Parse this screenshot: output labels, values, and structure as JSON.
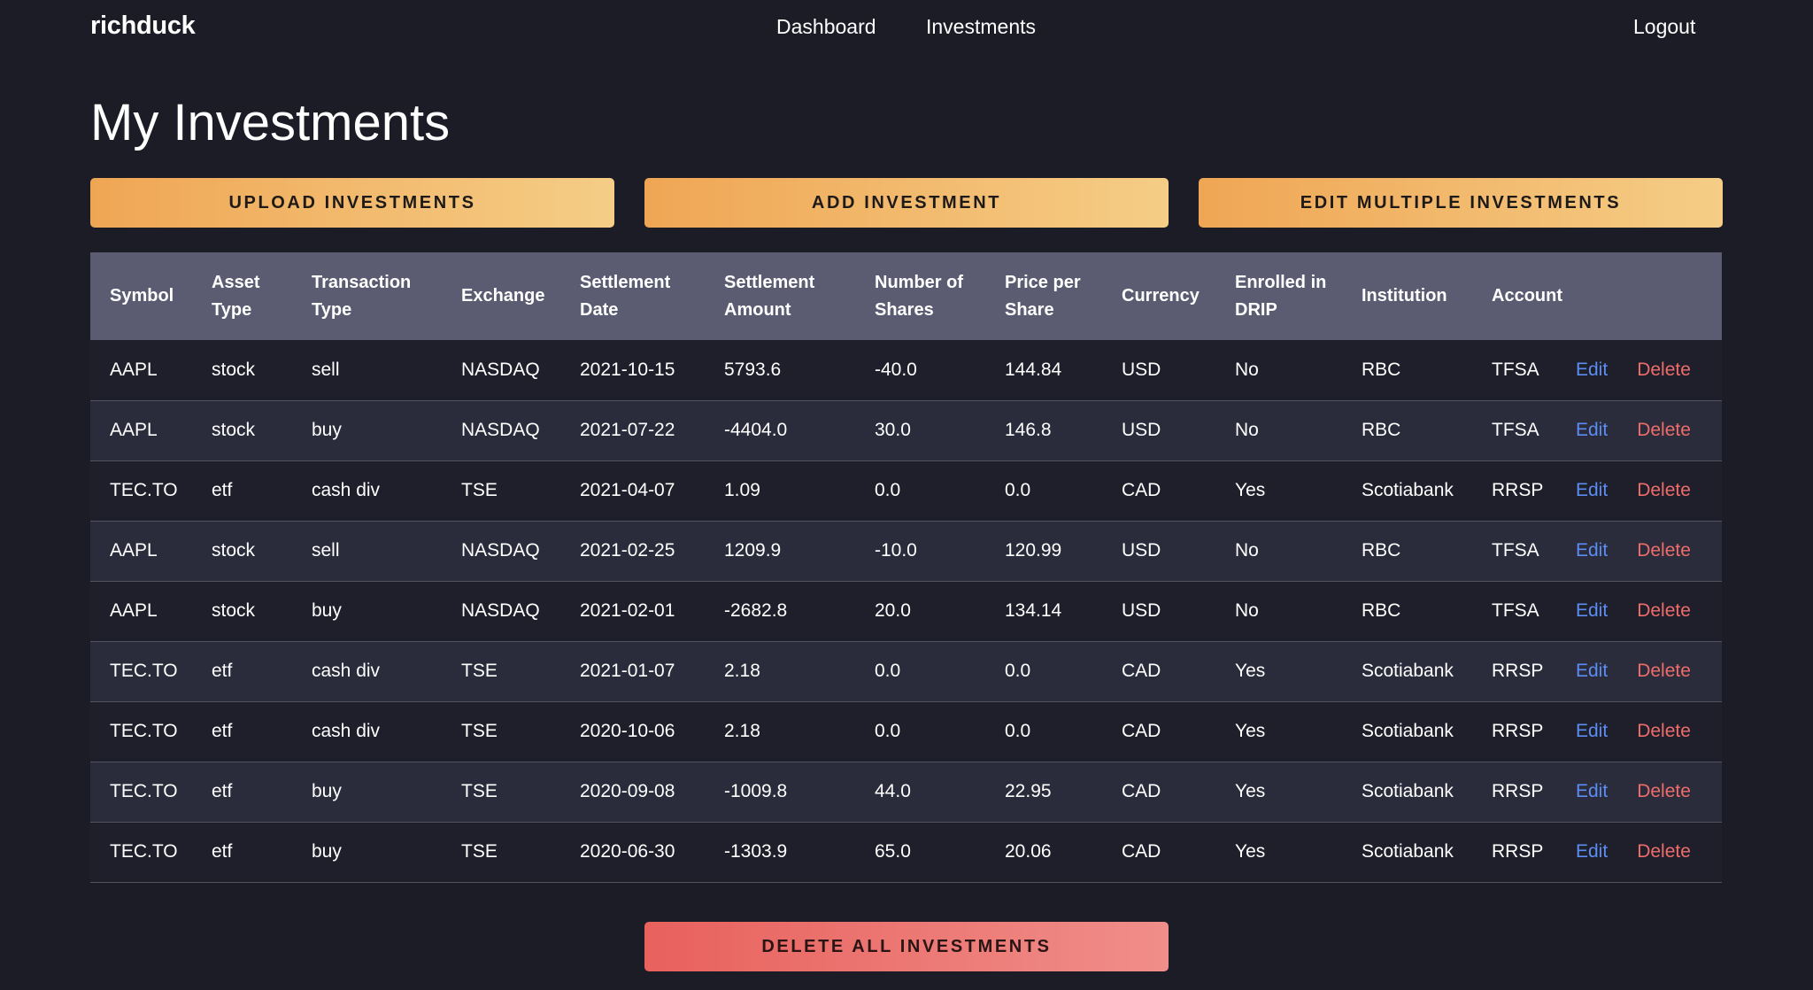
{
  "nav": {
    "brand": "richduck",
    "links": [
      {
        "label": "Dashboard"
      },
      {
        "label": "Investments"
      }
    ],
    "logout_label": "Logout"
  },
  "page_title": "My Investments",
  "actions": {
    "upload_label": "UPLOAD INVESTMENTS",
    "add_label": "ADD INVESTMENT",
    "edit_multiple_label": "EDIT MULTIPLE INVESTMENTS",
    "delete_all_label": "DELETE ALL INVESTMENTS"
  },
  "table": {
    "columns": [
      "Symbol",
      "Asset Type",
      "Transaction Type",
      "Exchange",
      "Settlement Date",
      "Settlement Amount",
      "Number of Shares",
      "Price per Share",
      "Currency",
      "Enrolled in DRIP",
      "Institution",
      "Account"
    ],
    "edit_label": "Edit",
    "delete_label": "Delete",
    "rows": [
      [
        "AAPL",
        "stock",
        "sell",
        "NASDAQ",
        "2021-10-15",
        "5793.6",
        "-40.0",
        "144.84",
        "USD",
        "No",
        "RBC",
        "TFSA"
      ],
      [
        "AAPL",
        "stock",
        "buy",
        "NASDAQ",
        "2021-07-22",
        "-4404.0",
        "30.0",
        "146.8",
        "USD",
        "No",
        "RBC",
        "TFSA"
      ],
      [
        "TEC.TO",
        "etf",
        "cash div",
        "TSE",
        "2021-04-07",
        "1.09",
        "0.0",
        "0.0",
        "CAD",
        "Yes",
        "Scotiabank",
        "RRSP"
      ],
      [
        "AAPL",
        "stock",
        "sell",
        "NASDAQ",
        "2021-02-25",
        "1209.9",
        "-10.0",
        "120.99",
        "USD",
        "No",
        "RBC",
        "TFSA"
      ],
      [
        "AAPL",
        "stock",
        "buy",
        "NASDAQ",
        "2021-02-01",
        "-2682.8",
        "20.0",
        "134.14",
        "USD",
        "No",
        "RBC",
        "TFSA"
      ],
      [
        "TEC.TO",
        "etf",
        "cash div",
        "TSE",
        "2021-01-07",
        "2.18",
        "0.0",
        "0.0",
        "CAD",
        "Yes",
        "Scotiabank",
        "RRSP"
      ],
      [
        "TEC.TO",
        "etf",
        "cash div",
        "TSE",
        "2020-10-06",
        "2.18",
        "0.0",
        "0.0",
        "CAD",
        "Yes",
        "Scotiabank",
        "RRSP"
      ],
      [
        "TEC.TO",
        "etf",
        "buy",
        "TSE",
        "2020-09-08",
        "-1009.8",
        "44.0",
        "22.95",
        "CAD",
        "Yes",
        "Scotiabank",
        "RRSP"
      ],
      [
        "TEC.TO",
        "etf",
        "buy",
        "TSE",
        "2020-06-30",
        "-1303.9",
        "65.0",
        "20.06",
        "CAD",
        "Yes",
        "Scotiabank",
        "RRSP"
      ]
    ]
  },
  "colors": {
    "background": "#1c1c26",
    "header_row": "#5b5c72",
    "primary_button": "#efa654",
    "danger_button": "#e8615d",
    "edit_link": "#5b8df2",
    "delete_link": "#ee6d6a"
  }
}
